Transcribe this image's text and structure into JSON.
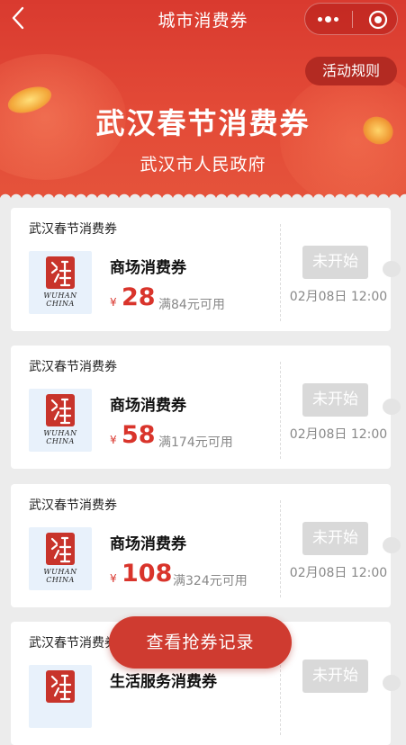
{
  "nav": {
    "title": "城市消费券",
    "rules_label": "活动规则"
  },
  "banner": {
    "title": "武汉春节消费券",
    "subtitle": "武汉市人民政府"
  },
  "coupons": [
    {
      "issuer": "武汉春节消费券",
      "name": "商场消费券",
      "currency": "¥",
      "amount": "28",
      "condition": "满84元可用",
      "status": "未开始",
      "start_time": "02月08日 12:00"
    },
    {
      "issuer": "武汉春节消费券",
      "name": "商场消费券",
      "currency": "¥",
      "amount": "58",
      "condition": "满174元可用",
      "status": "未开始",
      "start_time": "02月08日 12:00"
    },
    {
      "issuer": "武汉春节消费券",
      "name": "商场消费券",
      "currency": "¥",
      "amount": "108",
      "condition": "满324元可用",
      "status": "未开始",
      "start_time": "02月08日 12:00"
    },
    {
      "issuer": "武汉春节消费券",
      "name": "生活服务消费券",
      "currency": "¥",
      "amount": "",
      "condition": "",
      "status": "未开始",
      "start_time": ""
    }
  ],
  "logo": {
    "line1": "WUHAN",
    "line2": "CHINA"
  },
  "records_button": "查看抢券记录",
  "icons": [
    "back-arrow-icon",
    "more-dots-icon",
    "close-target-icon",
    "wuhan-logo-icon"
  ],
  "colors": {
    "brand_red": "#d93a2f",
    "amount_red": "#d9342b",
    "disabled_gray": "#d9d9d9"
  }
}
